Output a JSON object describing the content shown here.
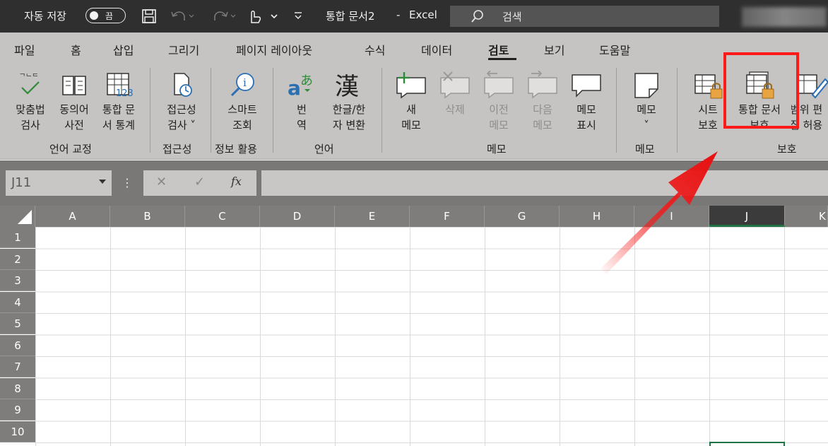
{
  "titlebar": {
    "autosave_label": "자동 저장",
    "autosave_state": "끔",
    "title": "통합 문서2",
    "separator": "-",
    "app": "Excel",
    "search_placeholder": "검색"
  },
  "tabs": [
    "파일",
    "홈",
    "삽입",
    "그리기",
    "페이지 레이아웃",
    "수식",
    "데이터",
    "검토",
    "보기",
    "도움말"
  ],
  "active_tab": "검토",
  "ribbon": {
    "commands": [
      {
        "label": "맞춤법\n검사",
        "icon": "spellcheck-icon"
      },
      {
        "label": "동의어\n사전",
        "icon": "thesaurus-icon"
      },
      {
        "label": "통합 문\n서 통계",
        "icon": "workbook-statistics-icon"
      },
      {
        "label": "접근성\n검사 ˅",
        "icon": "accessibility-icon"
      },
      {
        "label": "스마트\n조회",
        "icon": "smart-lookup-icon"
      },
      {
        "label": "번\n역",
        "icon": "translate-icon"
      },
      {
        "label": "한글/한\n자 변환",
        "icon": "hanja-convert-icon"
      },
      {
        "label": "새\n메모",
        "icon": "new-comment-icon"
      },
      {
        "label": "삭제",
        "icon": "delete-comment-icon"
      },
      {
        "label": "이전\n메모",
        "icon": "previous-comment-icon"
      },
      {
        "label": "다음\n메모",
        "icon": "next-comment-icon"
      },
      {
        "label": "메모\n표시",
        "icon": "show-comments-icon"
      },
      {
        "label": "메모\n˅",
        "icon": "notes-icon"
      },
      {
        "label": "시트\n보호",
        "icon": "protect-sheet-icon"
      },
      {
        "label": "통합 문서\n보호",
        "icon": "protect-workbook-icon"
      },
      {
        "label": "범위 편\n집 허용",
        "icon": "allow-edit-ranges-icon"
      }
    ],
    "groups": [
      "언어 교정",
      "접근성",
      "정보 활용",
      "언어",
      "메모",
      "메모",
      "보호"
    ]
  },
  "formula_bar": {
    "name_box": "J11",
    "dots": "⋮",
    "cancel": "✕",
    "enter": "✓",
    "fx": "fx"
  },
  "columns": [
    "A",
    "B",
    "C",
    "D",
    "E",
    "F",
    "G",
    "H",
    "I",
    "J",
    "K"
  ],
  "selected_column": "J",
  "rows": [
    "1",
    "2",
    "3",
    "4",
    "5",
    "6",
    "7",
    "8",
    "9",
    "10"
  ],
  "colors": {
    "accent": "#217346",
    "highlight": "#ff1a1a",
    "ribbon": "#c6c4c2",
    "titlebar": "#2f2f2f"
  }
}
